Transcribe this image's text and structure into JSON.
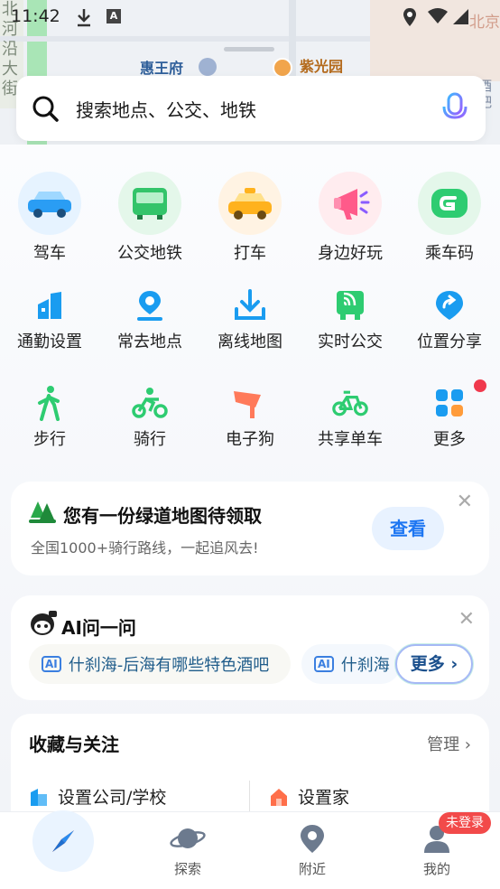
{
  "status": {
    "time": "11:42"
  },
  "map": {
    "street_label": "北河沿大街",
    "poi_1": "惠王府",
    "poi_2": "紫光园",
    "side_label": "酒吧",
    "corner_label": "北京"
  },
  "search": {
    "placeholder": "搜索地点、公交、地铁"
  },
  "primary_tiles": [
    {
      "label": "驾车",
      "icon": "car-icon",
      "bg": "#e6f3ff"
    },
    {
      "label": "公交地铁",
      "icon": "bus-icon",
      "bg": "#e4f7ea"
    },
    {
      "label": "打车",
      "icon": "taxi-icon",
      "bg": "#fff3e3"
    },
    {
      "label": "身边好玩",
      "icon": "megaphone-icon",
      "bg": "#ffecef"
    },
    {
      "label": "乘车码",
      "icon": "ride-code-icon",
      "bg": "#e4f7ea"
    }
  ],
  "row2": [
    {
      "label": "通勤设置",
      "icon": "commute-icon"
    },
    {
      "label": "常去地点",
      "icon": "frequent-place-icon"
    },
    {
      "label": "离线地图",
      "icon": "download-map-icon"
    },
    {
      "label": "实时公交",
      "icon": "realtime-bus-icon"
    },
    {
      "label": "位置分享",
      "icon": "share-location-icon"
    }
  ],
  "row3": [
    {
      "label": "步行",
      "icon": "walk-icon"
    },
    {
      "label": "骑行",
      "icon": "cycling-icon"
    },
    {
      "label": "电子狗",
      "icon": "speed-camera-icon"
    },
    {
      "label": "共享单车",
      "icon": "bike-share-icon"
    },
    {
      "label": "更多",
      "icon": "more-grid-icon"
    }
  ],
  "promo": {
    "title": "您有一份绿道地图待领取",
    "subtitle": "全国1000+骑行路线，一起追风去!",
    "button": "查看"
  },
  "ai": {
    "title": "AI问一问",
    "tag": "AI",
    "chips": [
      "什刹海-后海有哪些特色酒吧",
      "什刹海"
    ],
    "more": "更多 ›"
  },
  "favorites": {
    "title": "收藏与关注",
    "manage": "管理 ›",
    "work": "设置公司/学校",
    "home": "设置家"
  },
  "nav": {
    "explore": "探索",
    "nearby": "附近",
    "mine": "我的",
    "login_badge": "未登录"
  },
  "colors": {
    "accent": "#1d76f2",
    "green": "#2ecc71",
    "red_dot": "#f0394d"
  }
}
